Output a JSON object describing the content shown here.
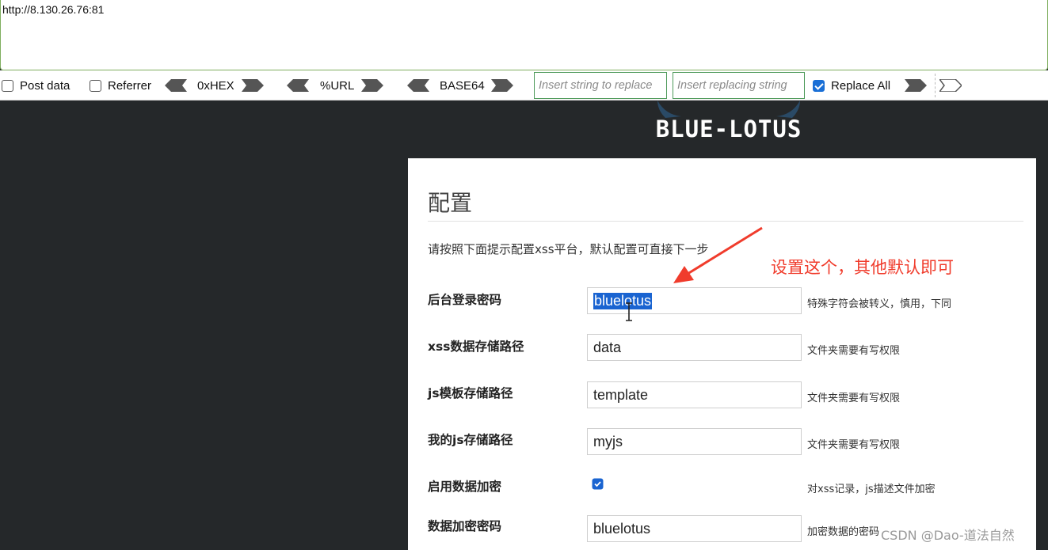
{
  "url": "http://8.130.26.76:81",
  "toolbar": {
    "post_data": "Post data",
    "referrer": "Referrer",
    "hex": "0xHEX",
    "url_enc": "%URL",
    "base64": "BASE64",
    "insert_replace_placeholder": "Insert string to replace",
    "insert_replacing_placeholder": "Insert replacing string",
    "replace_all": "Replace All"
  },
  "logo": {
    "text": "BLUE-LOTUS"
  },
  "panel": {
    "title": "配置",
    "description": "请按照下面提示配置xss平台，默认配置可直接下一步",
    "fields": [
      {
        "label": "后台登录密码",
        "value": "bluelotus",
        "hint": "特殊字符会被转义，慎用，下同"
      },
      {
        "label": "xss数据存储路径",
        "value": "data",
        "hint": "文件夹需要有写权限"
      },
      {
        "label": "js模板存储路径",
        "value": "template",
        "hint": "文件夹需要有写权限"
      },
      {
        "label": "我的js存储路径",
        "value": "myjs",
        "hint": "文件夹需要有写权限"
      },
      {
        "label": "启用数据加密",
        "hint": "对xss记录，js描述文件加密"
      },
      {
        "label": "数据加密密码",
        "value": "bluelotus",
        "hint": "加密数据的密码"
      }
    ]
  },
  "annotation": "设置这个，其他默认即可",
  "watermark": "CSDN @Dao-道法自然",
  "colors": {
    "accent": "#1a64d1",
    "annotation": "#f03c2c",
    "border_green": "#4e9a5a"
  },
  "icons": [
    "arrow-left-icon",
    "arrow-right-icon",
    "checkbox-icon",
    "text-cursor-icon",
    "annotation-arrow-icon"
  ]
}
